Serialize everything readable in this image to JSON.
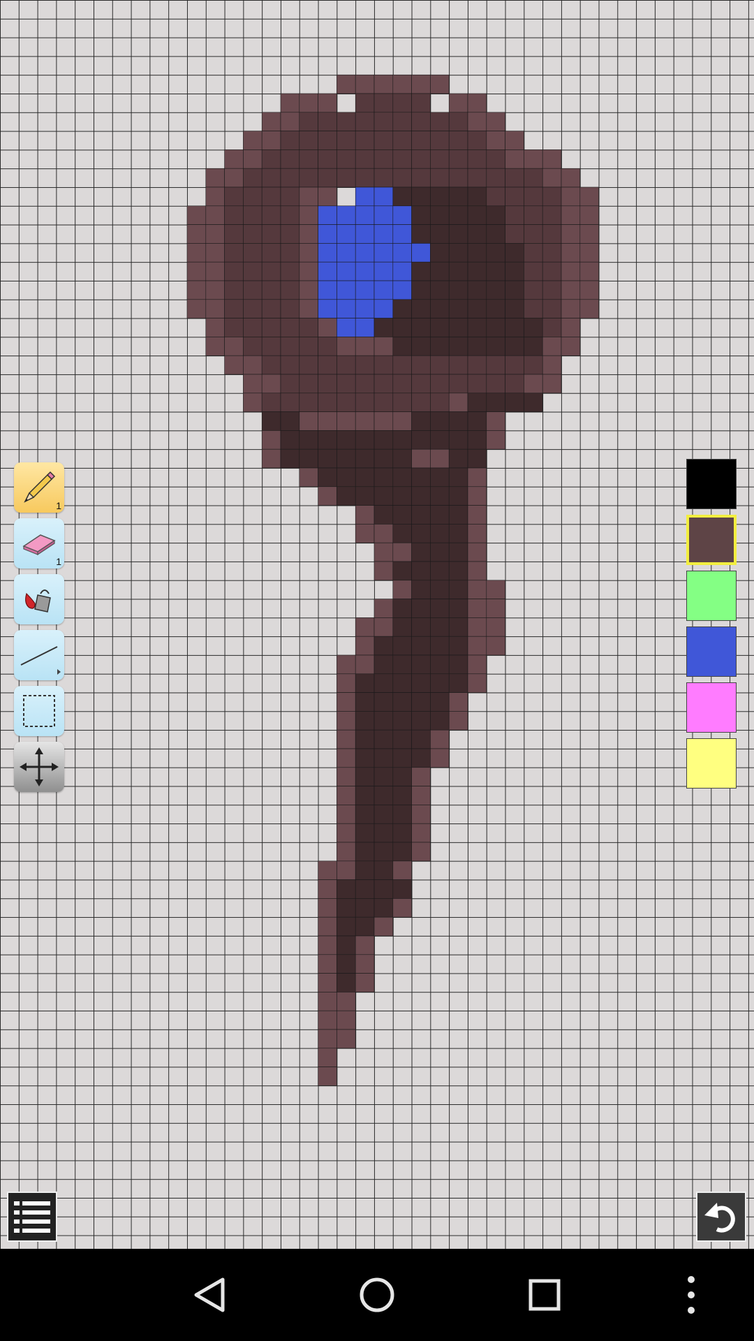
{
  "app": {
    "canvas": {
      "cols": 33,
      "rows": 67,
      "background_color": "#dcd9d9",
      "grid_color": "#2a2a2a"
    },
    "palette_colors": {
      "black": "#000000",
      "brown": "#5e4446",
      "green": "#84ff84",
      "blue": "#4057d8",
      "pink": "#ff7cff",
      "yellow": "#ffff80"
    }
  },
  "tools": [
    {
      "name": "pencil",
      "icon": "pencil-icon",
      "sub_label": "1",
      "active": true
    },
    {
      "name": "eraser",
      "icon": "eraser-icon",
      "sub_label": "1",
      "active": false
    },
    {
      "name": "fill",
      "icon": "paint-bucket-icon",
      "active": false
    },
    {
      "name": "line",
      "icon": "line-icon",
      "active": false
    },
    {
      "name": "select",
      "icon": "selection-rectangle-icon",
      "active": false
    },
    {
      "name": "move",
      "icon": "move-arrows-icon",
      "active": false
    }
  ],
  "palette": {
    "swatches": [
      "#000000",
      "#5e4446",
      "#84ff84",
      "#4057d8",
      "#ff7cff",
      "#ffff80"
    ],
    "selected_index": 1
  },
  "bottom_bar": {
    "menu_icon": "list-menu-icon",
    "undo_icon": "undo-icon"
  },
  "navbar": {
    "icons": [
      "back-triangle-icon",
      "home-circle-icon",
      "recents-square-icon",
      "more-vertical-icon"
    ]
  }
}
